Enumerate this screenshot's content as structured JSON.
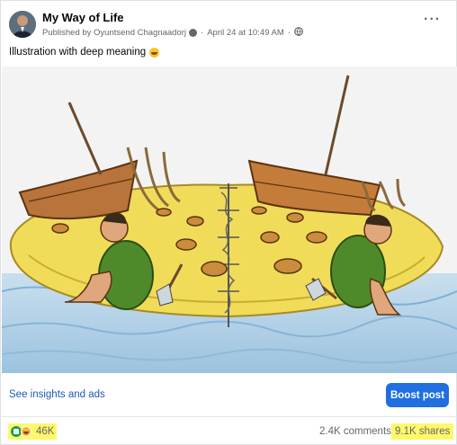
{
  "post": {
    "page_name": "My Way of Life",
    "published_by": "Published by Oyuntsend Chagnaadorj",
    "date": "April 24 at 10:49 AM",
    "separator": "·",
    "caption": "Illustration with deep meaning",
    "more_label": "···"
  },
  "actions": {
    "insights_label": "See insights and ads",
    "boost_label": "Boost post"
  },
  "stats": {
    "reaction_count": "46K",
    "comments": "2.4K comments",
    "shares": "9.1K shares"
  },
  "colors": {
    "link": "#1c58b4",
    "boost": "#1f6fe0",
    "highlight": "#fff86b",
    "island": "#f1dc5a"
  },
  "icons": {
    "avatar": "avatar",
    "info": "info-icon",
    "audience": "globe-icon",
    "more": "more-icon",
    "emoji": "grinning-emoji-icon",
    "like": "like-icon",
    "haha": "haha-icon"
  }
}
